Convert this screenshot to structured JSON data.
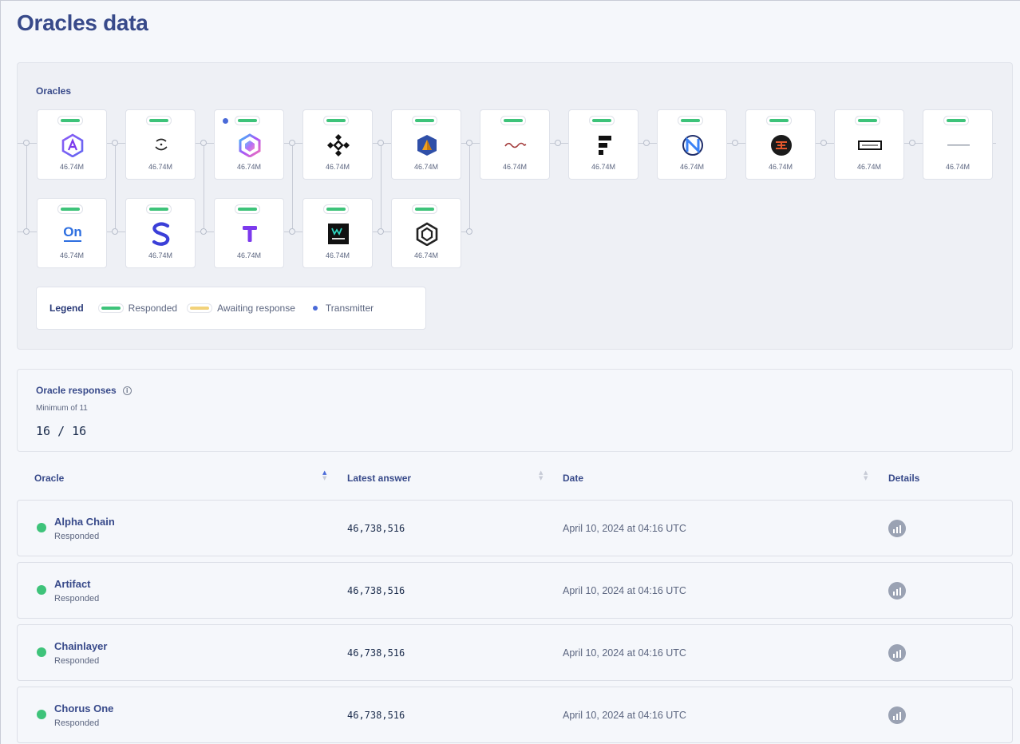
{
  "page": {
    "title": "Oracles data"
  },
  "oracles_panel": {
    "title": "Oracles",
    "nodes": [
      {
        "id": "alpha-chain",
        "value": "46.74M",
        "status": "responded",
        "transmitter": false,
        "icon": "alpha-chain-logo-icon"
      },
      {
        "id": "artifact",
        "value": "46.74M",
        "status": "responded",
        "transmitter": false,
        "icon": "artifact-logo-icon"
      },
      {
        "id": "chainlayer",
        "value": "46.74M",
        "status": "responded",
        "transmitter": true,
        "icon": "chainlayer-logo-icon"
      },
      {
        "id": "chorus-one",
        "value": "46.74M",
        "status": "responded",
        "transmitter": false,
        "icon": "chorus-one-logo-icon"
      },
      {
        "id": "cryptomanufaktur",
        "value": "46.74M",
        "status": "responded",
        "transmitter": false,
        "icon": "cryptomanufaktur-logo-icon"
      },
      {
        "id": "dextrac",
        "value": "46.74M",
        "status": "responded",
        "transmitter": false,
        "icon": "wave-logo-icon"
      },
      {
        "id": "fiews",
        "value": "46.74M",
        "status": "responded",
        "transmitter": false,
        "icon": "fiews-logo-icon"
      },
      {
        "id": "newroad",
        "value": "46.74M",
        "status": "responded",
        "transmitter": false,
        "icon": "newroad-logo-icon"
      },
      {
        "id": "piertwo",
        "value": "46.74M",
        "status": "responded",
        "transmitter": false,
        "icon": "round-logo-icon"
      },
      {
        "id": "frame",
        "value": "46.74M",
        "status": "responded",
        "transmitter": false,
        "icon": "frame-logo-icon"
      },
      {
        "id": "inotel",
        "value": "46.74M",
        "status": "responded",
        "transmitter": false,
        "icon": "wordmark-logo-icon"
      },
      {
        "id": "on",
        "value": "46.74M",
        "status": "responded",
        "transmitter": false,
        "icon": "on-logo-icon",
        "logo_text": "On"
      },
      {
        "id": "simplyvc",
        "value": "46.74M",
        "status": "responded",
        "transmitter": false,
        "icon": "s-logo-icon"
      },
      {
        "id": "t",
        "value": "46.74M",
        "status": "responded",
        "transmitter": false,
        "icon": "t-logo-icon"
      },
      {
        "id": "wetez",
        "value": "46.74M",
        "status": "responded",
        "transmitter": false,
        "icon": "wetez-logo-icon"
      },
      {
        "id": "hexagon",
        "value": "46.74M",
        "status": "responded",
        "transmitter": false,
        "icon": "hexagon-logo-icon"
      }
    ],
    "legend": {
      "title": "Legend",
      "items": [
        {
          "label": "Responded",
          "color": "#3ec37a"
        },
        {
          "label": "Awaiting response",
          "color": "#f2d27a"
        },
        {
          "label": "Transmitter",
          "color": "#4a6ad8"
        }
      ]
    }
  },
  "responses": {
    "title": "Oracle responses",
    "minimum": "Minimum of 11",
    "count": "16 / 16"
  },
  "table": {
    "columns": [
      "Oracle",
      "Latest answer",
      "Date",
      "Details"
    ],
    "rows": [
      {
        "oracle": "Alpha Chain",
        "status": "Responded",
        "answer": "46,738,516",
        "date": "April 10, 2024 at 04:16 UTC"
      },
      {
        "oracle": "Artifact",
        "status": "Responded",
        "answer": "46,738,516",
        "date": "April 10, 2024 at 04:16 UTC"
      },
      {
        "oracle": "Chainlayer",
        "status": "Responded",
        "answer": "46,738,516",
        "date": "April 10, 2024 at 04:16 UTC"
      },
      {
        "oracle": "Chorus One",
        "status": "Responded",
        "answer": "46,738,516",
        "date": "April 10, 2024 at 04:16 UTC"
      }
    ]
  },
  "colors": {
    "accent": "#384a8a",
    "responded": "#3ec37a",
    "awaiting": "#f2d27a",
    "transmitter": "#4a6ad8"
  }
}
